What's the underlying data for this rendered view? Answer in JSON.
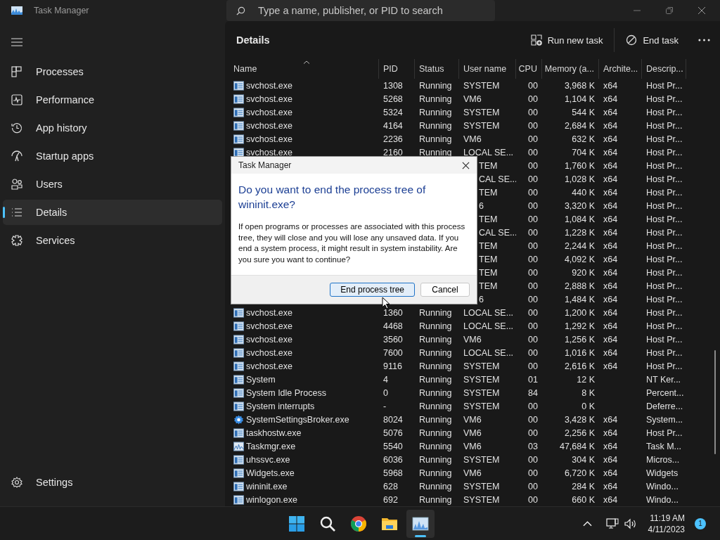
{
  "window": {
    "title": "Task Manager",
    "search": {
      "placeholder": "Type a name, publisher, or PID to search"
    }
  },
  "sidebar": {
    "items": [
      {
        "label": "Processes",
        "kind": "processes",
        "selected": false
      },
      {
        "label": "Performance",
        "kind": "performance",
        "selected": false
      },
      {
        "label": "App history",
        "kind": "history",
        "selected": false
      },
      {
        "label": "Startup apps",
        "kind": "startup",
        "selected": false
      },
      {
        "label": "Users",
        "kind": "users",
        "selected": false
      },
      {
        "label": "Details",
        "kind": "details",
        "selected": true
      },
      {
        "label": "Services",
        "kind": "services",
        "selected": false
      }
    ],
    "settings": "Settings"
  },
  "page": {
    "title": "Details",
    "actions": [
      {
        "label": "Run new task",
        "kind": "run"
      },
      {
        "label": "End task",
        "kind": "end"
      }
    ]
  },
  "table": {
    "columns": [
      "Name",
      "PID",
      "Status",
      "User name",
      "CPU",
      "Memory (a...",
      "Archite...",
      "Descrip..."
    ],
    "rows": [
      {
        "kind": "window",
        "covered": false,
        "name": "svchost.exe",
        "pid": "1308",
        "status": "Running",
        "user": "SYSTEM",
        "cpu": "00",
        "memory": "3,968 K",
        "arch": "x64",
        "desc": "Host Pr..."
      },
      {
        "kind": "window",
        "covered": false,
        "name": "svchost.exe",
        "pid": "5268",
        "status": "Running",
        "user": "VM6",
        "cpu": "00",
        "memory": "1,104 K",
        "arch": "x64",
        "desc": "Host Pr..."
      },
      {
        "kind": "window",
        "covered": false,
        "name": "svchost.exe",
        "pid": "5324",
        "status": "Running",
        "user": "SYSTEM",
        "cpu": "00",
        "memory": "544 K",
        "arch": "x64",
        "desc": "Host Pr..."
      },
      {
        "kind": "window",
        "covered": false,
        "name": "svchost.exe",
        "pid": "4164",
        "status": "Running",
        "user": "SYSTEM",
        "cpu": "00",
        "memory": "2,684 K",
        "arch": "x64",
        "desc": "Host Pr..."
      },
      {
        "kind": "window",
        "covered": false,
        "name": "svchost.exe",
        "pid": "2236",
        "status": "Running",
        "user": "VM6",
        "cpu": "00",
        "memory": "632 K",
        "arch": "x64",
        "desc": "Host Pr..."
      },
      {
        "kind": "window",
        "covered": false,
        "name": "svchost.exe",
        "pid": "2160",
        "status": "Running",
        "user": "LOCAL SE...",
        "cpu": "00",
        "memory": "704 K",
        "arch": "x64",
        "desc": "Host Pr..."
      },
      {
        "covered": true,
        "user": "TEM",
        "cpu": "00",
        "memory": "1,760 K",
        "arch": "x64",
        "desc": "Host Pr..."
      },
      {
        "covered": true,
        "user": "CAL SE...",
        "cpu": "00",
        "memory": "1,028 K",
        "arch": "x64",
        "desc": "Host Pr..."
      },
      {
        "covered": true,
        "user": "TEM",
        "cpu": "00",
        "memory": "440 K",
        "arch": "x64",
        "desc": "Host Pr..."
      },
      {
        "covered": true,
        "user": "6",
        "cpu": "00",
        "memory": "3,320 K",
        "arch": "x64",
        "desc": "Host Pr..."
      },
      {
        "covered": true,
        "user": "TEM",
        "cpu": "00",
        "memory": "1,084 K",
        "arch": "x64",
        "desc": "Host Pr..."
      },
      {
        "covered": true,
        "user": "CAL SE...",
        "cpu": "00",
        "memory": "1,228 K",
        "arch": "x64",
        "desc": "Host Pr..."
      },
      {
        "covered": true,
        "user": "TEM",
        "cpu": "00",
        "memory": "2,244 K",
        "arch": "x64",
        "desc": "Host Pr..."
      },
      {
        "covered": true,
        "user": "TEM",
        "cpu": "00",
        "memory": "4,092 K",
        "arch": "x64",
        "desc": "Host Pr..."
      },
      {
        "covered": true,
        "user": "TEM",
        "cpu": "00",
        "memory": "920 K",
        "arch": "x64",
        "desc": "Host Pr..."
      },
      {
        "covered": true,
        "user": "TEM",
        "cpu": "00",
        "memory": "2,888 K",
        "arch": "x64",
        "desc": "Host Pr..."
      },
      {
        "covered": true,
        "user": "6",
        "cpu": "00",
        "memory": "1,484 K",
        "arch": "x64",
        "desc": "Host Pr..."
      },
      {
        "kind": "window",
        "covered": false,
        "name": "svchost.exe",
        "pid": "1360",
        "status": "Running",
        "user": "LOCAL SE...",
        "cpu": "00",
        "memory": "1,200 K",
        "arch": "x64",
        "desc": "Host Pr..."
      },
      {
        "kind": "window",
        "covered": false,
        "name": "svchost.exe",
        "pid": "4468",
        "status": "Running",
        "user": "LOCAL SE...",
        "cpu": "00",
        "memory": "1,292 K",
        "arch": "x64",
        "desc": "Host Pr..."
      },
      {
        "kind": "window",
        "covered": false,
        "name": "svchost.exe",
        "pid": "3560",
        "status": "Running",
        "user": "VM6",
        "cpu": "00",
        "memory": "1,256 K",
        "arch": "x64",
        "desc": "Host Pr..."
      },
      {
        "kind": "window",
        "covered": false,
        "name": "svchost.exe",
        "pid": "7600",
        "status": "Running",
        "user": "LOCAL SE...",
        "cpu": "00",
        "memory": "1,016 K",
        "arch": "x64",
        "desc": "Host Pr..."
      },
      {
        "kind": "window",
        "covered": false,
        "name": "svchost.exe",
        "pid": "9116",
        "status": "Running",
        "user": "SYSTEM",
        "cpu": "00",
        "memory": "2,616 K",
        "arch": "x64",
        "desc": "Host Pr..."
      },
      {
        "kind": "window",
        "covered": false,
        "name": "System",
        "pid": "4",
        "status": "Running",
        "user": "SYSTEM",
        "cpu": "01",
        "memory": "12 K",
        "desc": "NT Ker..."
      },
      {
        "kind": "window",
        "covered": false,
        "name": "System Idle Process",
        "pid": "0",
        "status": "Running",
        "user": "SYSTEM",
        "cpu": "84",
        "memory": "8 K",
        "desc": "Percent..."
      },
      {
        "kind": "window",
        "covered": false,
        "name": "System interrupts",
        "pid": "-",
        "status": "Running",
        "user": "SYSTEM",
        "cpu": "00",
        "memory": "0 K",
        "desc": "Deferre..."
      },
      {
        "kind": "gear",
        "covered": false,
        "name": "SystemSettingsBroker.exe",
        "pid": "8024",
        "status": "Running",
        "user": "VM6",
        "cpu": "00",
        "memory": "3,428 K",
        "arch": "x64",
        "desc": "System..."
      },
      {
        "kind": "window",
        "covered": false,
        "name": "taskhostw.exe",
        "pid": "5076",
        "status": "Running",
        "user": "VM6",
        "cpu": "00",
        "memory": "2,256 K",
        "arch": "x64",
        "desc": "Host Pr..."
      },
      {
        "kind": "chart",
        "covered": false,
        "name": "Taskmgr.exe",
        "pid": "5540",
        "status": "Running",
        "user": "VM6",
        "cpu": "03",
        "memory": "47,684 K",
        "arch": "x64",
        "desc": "Task M..."
      },
      {
        "kind": "window",
        "covered": false,
        "name": "uhssvc.exe",
        "pid": "6036",
        "status": "Running",
        "user": "SYSTEM",
        "cpu": "00",
        "memory": "304 K",
        "arch": "x64",
        "desc": "Micros..."
      },
      {
        "kind": "window",
        "covered": false,
        "name": "Widgets.exe",
        "pid": "5968",
        "status": "Running",
        "user": "VM6",
        "cpu": "00",
        "memory": "6,720 K",
        "arch": "x64",
        "desc": "Widgets"
      },
      {
        "kind": "window",
        "covered": false,
        "name": "wininit.exe",
        "pid": "628",
        "status": "Running",
        "user": "SYSTEM",
        "cpu": "00",
        "memory": "284 K",
        "arch": "x64",
        "desc": "Windo..."
      },
      {
        "kind": "window",
        "covered": false,
        "name": "winlogon.exe",
        "pid": "692",
        "status": "Running",
        "user": "SYSTEM",
        "cpu": "00",
        "memory": "660 K",
        "arch": "x64",
        "desc": "Windo..."
      }
    ]
  },
  "dialog": {
    "title": "Task Manager",
    "heading": "Do you want to end the process tree of wininit.exe?",
    "message": "If open programs or processes are associated with this process tree, they will close and you will lose any unsaved data. If you end a system process, it might result in system instability. Are you sure you want to continue?",
    "buttons": [
      {
        "label": "End process tree",
        "selected": true
      },
      {
        "label": "Cancel",
        "selected": false
      }
    ]
  },
  "taskbar": {
    "apps": [
      {
        "kind": "start",
        "selected": false
      },
      {
        "kind": "search",
        "selected": false
      },
      {
        "kind": "browser",
        "selected": false
      },
      {
        "kind": "folder",
        "selected": false
      },
      {
        "kind": "taskmgr",
        "selected": true
      }
    ],
    "time": "11:19 AM",
    "date": "4/11/2023",
    "badge": "1"
  }
}
